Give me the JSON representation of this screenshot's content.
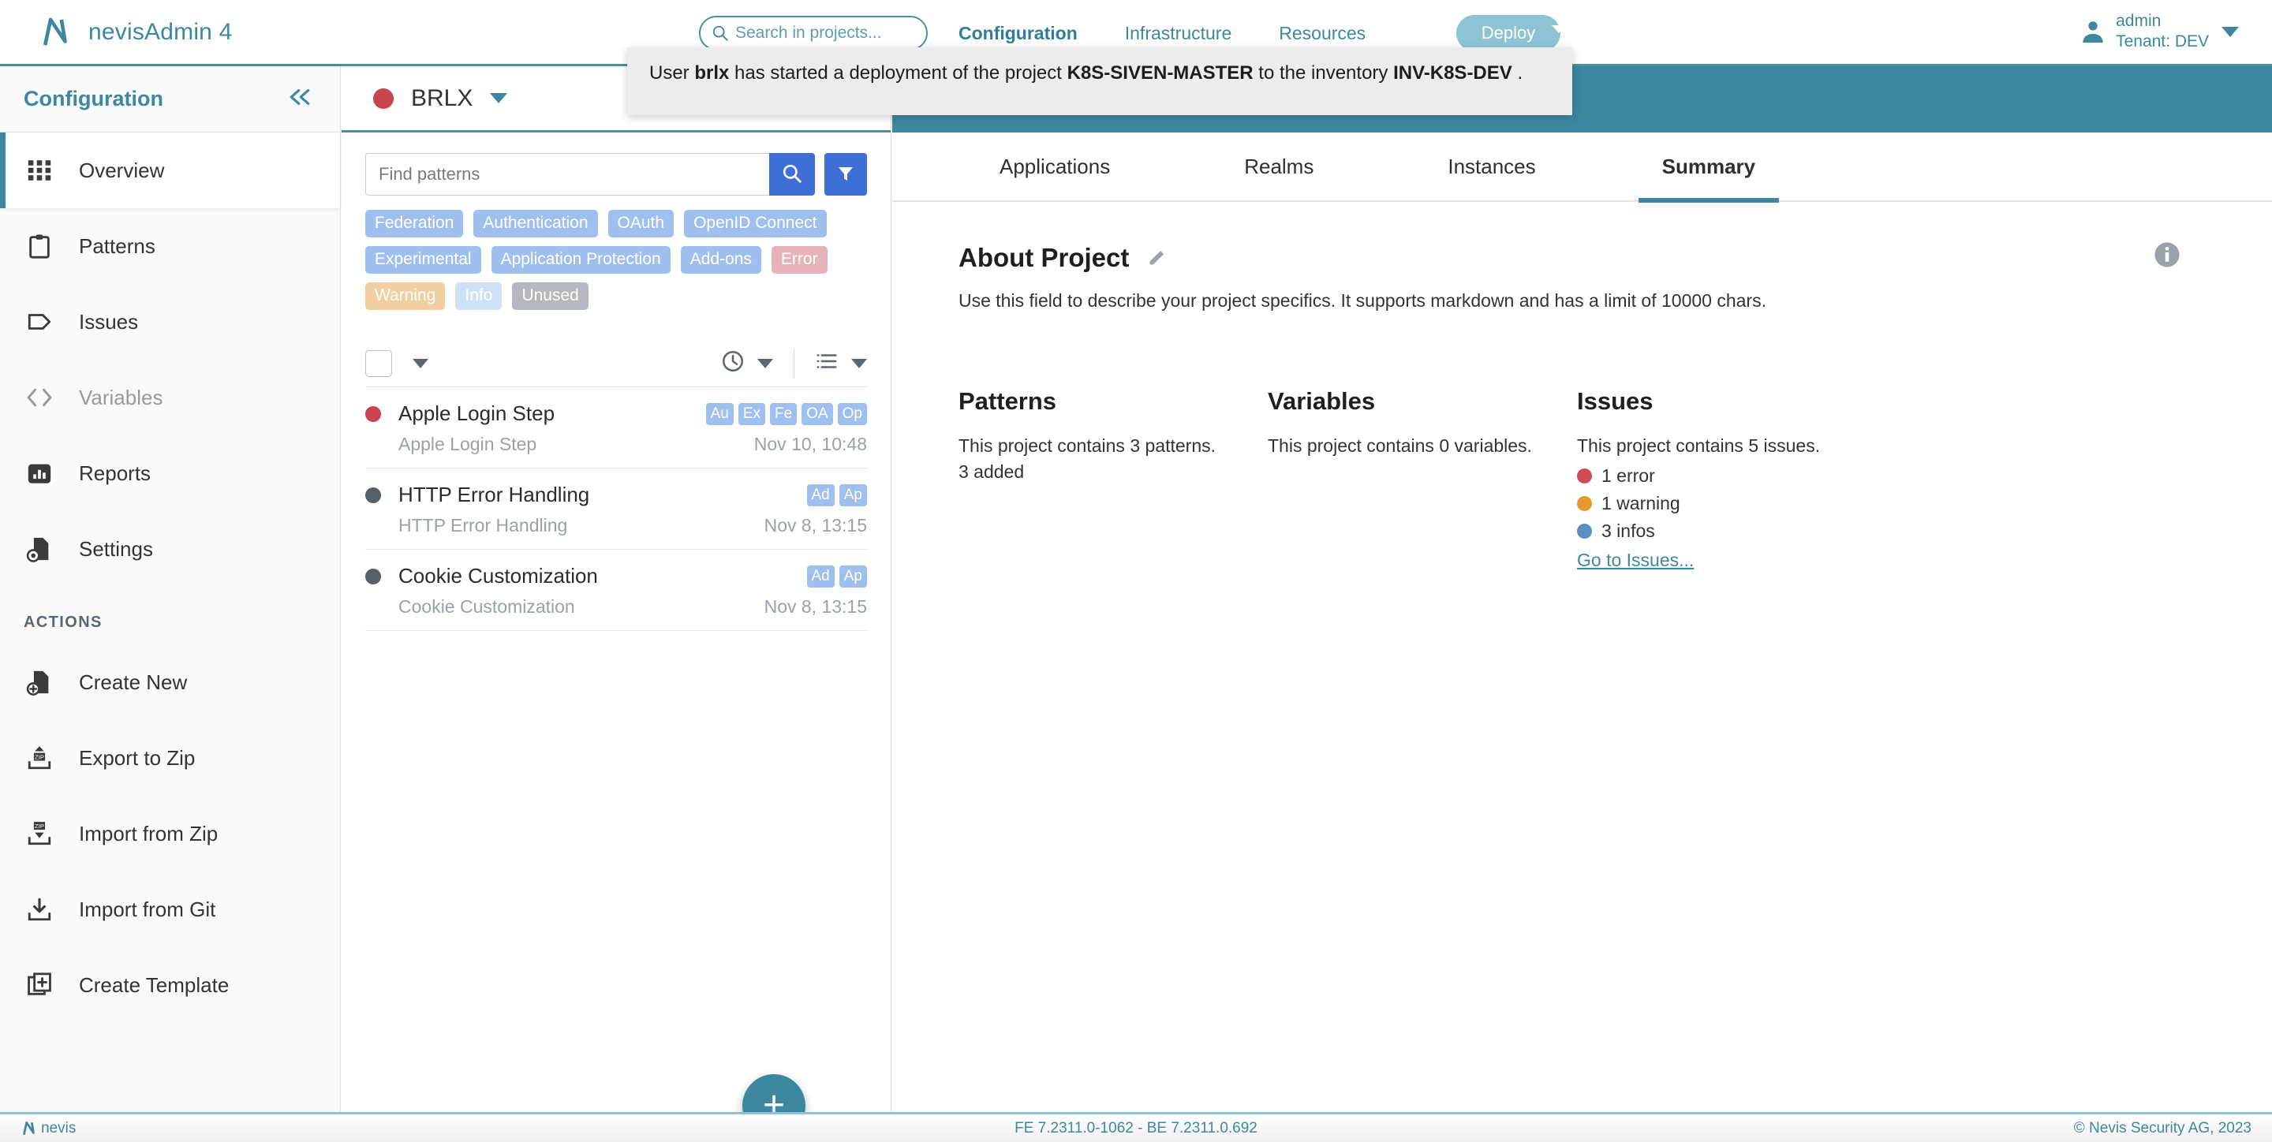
{
  "topbar": {
    "brand": "nevisAdmin 4",
    "logo_icon": "nevis-logo-icon",
    "search": {
      "placeholder": "Search in projects...",
      "value": "",
      "icon": "search-icon"
    },
    "nav": [
      {
        "label": "Configuration",
        "active": true
      },
      {
        "label": "Infrastructure",
        "active": false
      },
      {
        "label": "Resources",
        "active": false
      }
    ],
    "deploy_label": "Deploy",
    "deploy_color": "#8ec3d4",
    "user": {
      "name": "admin",
      "tenant": "Tenant: DEV",
      "avatar_icon": "user-avatar-icon",
      "caret_icon": "chevron-down-icon"
    }
  },
  "toast": {
    "prefix": "User ",
    "user": "brlx",
    "mid1": " has started a deployment of the project ",
    "project": "K8S-SIVEN-MASTER",
    "mid2": " to the inventory ",
    "inventory": "INV-K8S-DEV",
    "suffix": " ."
  },
  "sidebar": {
    "title": "Configuration",
    "collapse_icon": "chevron-double-left-icon",
    "items": [
      {
        "label": "Overview",
        "icon": "grid-icon",
        "active": true,
        "disabled": false
      },
      {
        "label": "Patterns",
        "icon": "clipboard-icon",
        "active": false,
        "disabled": false
      },
      {
        "label": "Issues",
        "icon": "tag-icon",
        "active": false,
        "disabled": false
      },
      {
        "label": "Variables",
        "icon": "code-brackets-icon",
        "active": false,
        "disabled": true
      },
      {
        "label": "Reports",
        "icon": "bar-chart-icon",
        "active": false,
        "disabled": false
      },
      {
        "label": "Settings",
        "icon": "file-gear-icon",
        "active": false,
        "disabled": false
      }
    ],
    "actions_header": "ACTIONS",
    "actions": [
      {
        "label": "Create New",
        "icon": "file-plus-icon"
      },
      {
        "label": "Export to Zip",
        "icon": "zip-upload-icon"
      },
      {
        "label": "Import from Zip",
        "icon": "zip-download-icon"
      },
      {
        "label": "Import from Git",
        "icon": "download-icon"
      },
      {
        "label": "Create Template",
        "icon": "copy-plus-icon"
      }
    ]
  },
  "patterns_panel": {
    "project": {
      "name": "BRLX",
      "status_color": "#c9444f",
      "caret_icon": "chevron-down-icon"
    },
    "find": {
      "placeholder": "Find patterns",
      "value": "",
      "search_icon": "search-icon",
      "filter_icon": "funnel-icon"
    },
    "chips": [
      {
        "label": "Federation",
        "color": "#9fc0ef"
      },
      {
        "label": "Authentication",
        "color": "#9fc0ef"
      },
      {
        "label": "OAuth",
        "color": "#9fc0ef"
      },
      {
        "label": "OpenID Connect",
        "color": "#9fc0ef"
      },
      {
        "label": "Experimental",
        "color": "#9fc0ef"
      },
      {
        "label": "Application Protection",
        "color": "#9fc0ef"
      },
      {
        "label": "Add-ons",
        "color": "#9fc0ef"
      },
      {
        "label": "Error",
        "color": "#e7b3ba"
      },
      {
        "label": "Warning",
        "color": "#f2cf9e"
      },
      {
        "label": "Info",
        "color": "#cfe2f5"
      },
      {
        "label": "Unused",
        "color": "#b5b8bc"
      }
    ],
    "toolbar": {
      "select_all_icon": "checkbox-icon",
      "select_caret_icon": "chevron-down-icon",
      "clock_icon": "clock-icon",
      "clock_caret_icon": "chevron-down-icon",
      "list_icon": "list-view-icon",
      "list_caret_icon": "chevron-down-icon"
    },
    "items": [
      {
        "title": "Apple Login Step",
        "subtitle": "Apple Login Step",
        "date": "Nov 10, 10:48",
        "status_color": "#c9444f",
        "badges": [
          "Au",
          "Ex",
          "Fe",
          "OA",
          "Op"
        ]
      },
      {
        "title": "HTTP Error Handling",
        "subtitle": "HTTP Error Handling",
        "date": "Nov 8, 13:15",
        "status_color": "#55606a",
        "badges": [
          "Ad",
          "Ap"
        ]
      },
      {
        "title": "Cookie Customization",
        "subtitle": "Cookie Customization",
        "date": "Nov 8, 13:15",
        "status_color": "#55606a",
        "badges": [
          "Ad",
          "Ap"
        ]
      }
    ],
    "fab": {
      "icon": "plus-icon",
      "color": "#3d87a0"
    }
  },
  "content": {
    "tabs": [
      {
        "label": "Applications",
        "active": false
      },
      {
        "label": "Realms",
        "active": false
      },
      {
        "label": "Instances",
        "active": false
      },
      {
        "label": "Summary",
        "active": true
      }
    ],
    "about": {
      "title": "About Project",
      "edit_icon": "pencil-icon",
      "description": "Use this field to describe your project specifics. It supports markdown and has a limit of 10000 chars.",
      "info_icon": "info-icon"
    },
    "summary": {
      "patterns": {
        "title": "Patterns",
        "line1": "This project contains 3 patterns.",
        "line2": "3 added"
      },
      "variables": {
        "title": "Variables",
        "line1": "This project contains 0 variables."
      },
      "issues": {
        "title": "Issues",
        "line1": "This project contains 5 issues.",
        "rows": [
          {
            "label": "1 error",
            "color": "#cf4a55"
          },
          {
            "label": "1 warning",
            "color": "#e8972a"
          },
          {
            "label": "3 infos",
            "color": "#5b8ec4"
          }
        ],
        "link": "Go to Issues..."
      }
    }
  },
  "footer": {
    "logo_text": "nevis",
    "logo_icon": "nevis-logo-icon",
    "version": "FE 7.2311.0-1062 - BE 7.2311.0.692",
    "copyright": "© Nevis Security AG, 2023"
  }
}
